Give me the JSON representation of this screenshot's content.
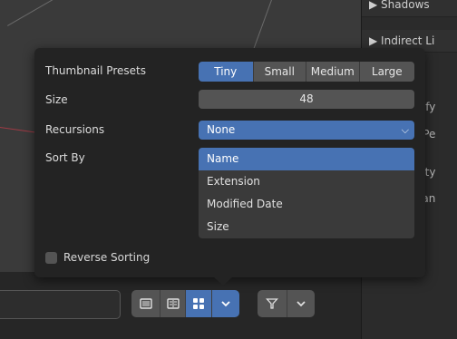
{
  "popup": {
    "thumbnail_presets": {
      "label": "Thumbnail Presets",
      "options": [
        "Tiny",
        "Small",
        "Medium",
        "Large"
      ],
      "selected": "Tiny"
    },
    "size": {
      "label": "Size",
      "value": "48"
    },
    "recursions": {
      "label": "Recursions",
      "value": "None"
    },
    "sort_by": {
      "label": "Sort By",
      "options": [
        "Name",
        "Extension",
        "Modified Date",
        "Size"
      ],
      "selected": "Name"
    },
    "reverse_sorting": {
      "label": "Reverse Sorting",
      "checked": false
    }
  },
  "right_panel": {
    "items": [
      {
        "label": "▶ Shadows"
      },
      {
        "label": "▶ Indirect Li"
      }
    ],
    "fragments": [
      "plify",
      "e Pe",
      "esty",
      "Man"
    ]
  },
  "toolbar": {
    "view_buttons": [
      "list-vertical-icon",
      "list-horizontal-icon",
      "thumbnails-icon"
    ],
    "active_view": "thumbnails-icon",
    "filter_icon": "filter-icon"
  },
  "colors": {
    "accent": "#4772b3",
    "popup_bg": "#232323",
    "field_bg": "#545454"
  }
}
